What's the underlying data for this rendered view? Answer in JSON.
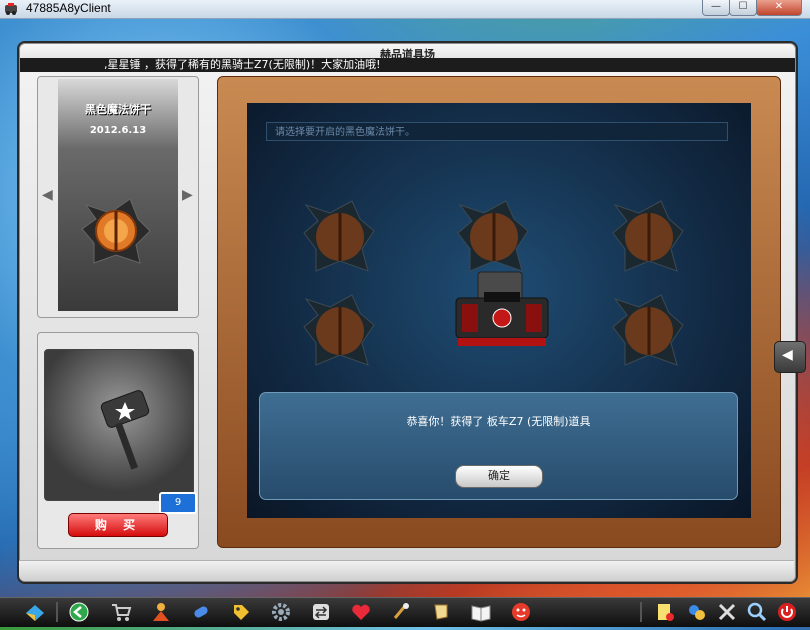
{
  "window": {
    "title": "47885A8yClient",
    "min": "—",
    "max": "☐",
    "close": "✕"
  },
  "panel": {
    "title": "赫品道具场",
    "ticker": ",星星锤  ，获得了稀有的黑骑士Z7(无限制)！大家加油哦!"
  },
  "item_card": {
    "name": "黑色魔法饼干",
    "date": "2012.6.13",
    "prev": "◀",
    "next": "▶"
  },
  "shop": {
    "count": "9",
    "buy_label": "购 买"
  },
  "board": {
    "search_placeholder": "请选择要开启的黑色魔法饼干。",
    "popup_message": "恭喜你！获得了 板车Z7 (无限制)道具",
    "ok_label": "确定"
  },
  "side_button": {
    "label": "◀"
  },
  "colors": {
    "accent_red": "#d40c0c",
    "board_blue": "#122a44",
    "frame_wood": "#a8683a"
  },
  "taskbar_icons": [
    "start-icon",
    "back-icon",
    "cart-icon",
    "character-icon",
    "capsule-icon",
    "tag-icon",
    "gear-icon",
    "exchange-icon",
    "heart-icon",
    "tools-icon",
    "scroll-icon",
    "book-icon",
    "face-icon",
    "notes-icon",
    "puzzle-icon",
    "settings-icon",
    "magnify-icon",
    "power-icon"
  ]
}
